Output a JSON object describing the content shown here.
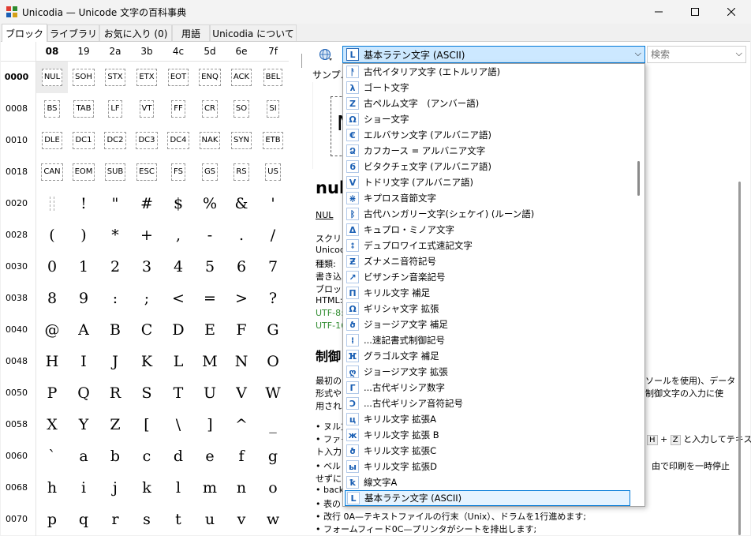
{
  "window": {
    "title": "Unicodia — Unicode 文字の百科事典",
    "minimize": "—",
    "maximize": "☐",
    "close": "✕"
  },
  "tabs": [
    {
      "label": "ブロック",
      "active": true
    },
    {
      "label": "ライブラリ"
    },
    {
      "label": "お気に入り (0)"
    },
    {
      "label": "用語"
    },
    {
      "label": "Unicodia について"
    }
  ],
  "grid": {
    "columns": [
      "08",
      "19",
      "2a",
      "3b",
      "4c",
      "5d",
      "6e",
      "7f"
    ],
    "active_column": "08",
    "rows": [
      {
        "label": "0000",
        "cells": [
          "NUL",
          "SOH",
          "STX",
          "ETX",
          "EOT",
          "ENQ",
          "ACK",
          "BEL"
        ],
        "control": true
      },
      {
        "label": "0008",
        "cells": [
          "BS",
          "TAB",
          "LF",
          "VT",
          "FF",
          "CR",
          "SO",
          "SI"
        ],
        "control": true
      },
      {
        "label": "0010",
        "cells": [
          "DLE",
          "DC1",
          "DC2",
          "DC3",
          "DC4",
          "NAK",
          "SYN",
          "ETB"
        ],
        "control": true
      },
      {
        "label": "0018",
        "cells": [
          "CAN",
          "EOM",
          "SUB",
          "ESC",
          "FS",
          "GS",
          "RS",
          "US"
        ],
        "control": true
      },
      {
        "label": "0020",
        "cells": [
          " ",
          "!",
          "\"",
          "#",
          "$",
          "%",
          "&",
          "'"
        ]
      },
      {
        "label": "0028",
        "cells": [
          "(",
          ")",
          "*",
          "+",
          ",",
          "-",
          ".",
          "/"
        ]
      },
      {
        "label": "0030",
        "cells": [
          "0",
          "1",
          "2",
          "3",
          "4",
          "5",
          "6",
          "7"
        ]
      },
      {
        "label": "0038",
        "cells": [
          "8",
          "9",
          ":",
          ";",
          "<",
          "=",
          ">",
          "?"
        ]
      },
      {
        "label": "0040",
        "cells": [
          "@",
          "A",
          "B",
          "C",
          "D",
          "E",
          "F",
          "G"
        ]
      },
      {
        "label": "0048",
        "cells": [
          "H",
          "I",
          "J",
          "K",
          "L",
          "M",
          "N",
          "O"
        ]
      },
      {
        "label": "0050",
        "cells": [
          "P",
          "Q",
          "R",
          "S",
          "T",
          "U",
          "V",
          "W"
        ]
      },
      {
        "label": "0058",
        "cells": [
          "X",
          "Y",
          "Z",
          "[",
          "\\",
          "]",
          "^",
          "_"
        ]
      },
      {
        "label": "0060",
        "cells": [
          "`",
          "a",
          "b",
          "c",
          "d",
          "e",
          "f",
          "g"
        ]
      },
      {
        "label": "0068",
        "cells": [
          "h",
          "i",
          "j",
          "k",
          "l",
          "m",
          "n",
          "o"
        ]
      },
      {
        "label": "0070",
        "cells": [
          "p",
          "q",
          "r",
          "s",
          "t",
          "u",
          "v",
          "w"
        ]
      }
    ]
  },
  "block_combo": {
    "icon": "L",
    "value": "基本ラテン文字 (ASCII)",
    "arrow": "⌵"
  },
  "search": {
    "placeholder": "検索",
    "arrow": "⌵"
  },
  "dropdown_items": [
    {
      "icon": "ᚨ",
      "label": "古代イタリア文字 (エトルリア語)"
    },
    {
      "icon": "λ",
      "label": "ゴート文字"
    },
    {
      "icon": "Z",
      "label": "古ペルム文字　(アンバー語)"
    },
    {
      "icon": "Ω",
      "label": "ショー文字"
    },
    {
      "icon": "€",
      "label": "エルバサン文字 (アルバニア語)"
    },
    {
      "icon": "Ձ",
      "label": "カフカース = アルバニア文字"
    },
    {
      "icon": "ϭ",
      "label": "ビタクチェ文字 (アルバニア語)"
    },
    {
      "icon": "V",
      "label": "トドリ文字 (アルバニア語)"
    },
    {
      "icon": "⋇",
      "label": "キプロス音節文字"
    },
    {
      "icon": "ᛒ",
      "label": "古代ハンガリー文字(シェケイ) (ルーン語)"
    },
    {
      "icon": "Δ",
      "label": "キュプロ・ミノア文字"
    },
    {
      "icon": "⦂",
      "label": "デュプロワイエ式速記文字"
    },
    {
      "icon": "Ƶ",
      "label": "ズナメニ音符記号"
    },
    {
      "icon": "↗",
      "label": "ビザンチン音楽記号"
    },
    {
      "icon": "Π",
      "label": "キリル文字 補足"
    },
    {
      "icon": "Ω",
      "label": "ギリシャ文字 拡張"
    },
    {
      "icon": "ծ",
      "label": "ジョージア文字 補足"
    },
    {
      "icon": "⁞",
      "label": "...速記書式制御記号"
    },
    {
      "icon": "ⴼ",
      "label": "グラゴル文字 補足"
    },
    {
      "icon": "ღ",
      "label": "ジョージア文字 拡張"
    },
    {
      "icon": "Γ",
      "label": "...古代ギリシア数字"
    },
    {
      "icon": "Ↄ",
      "label": "...古代ギリシア音符記号"
    },
    {
      "icon": "ц",
      "label": "キリル文字 拡張A"
    },
    {
      "icon": "ж",
      "label": "キリル文字 拡張 B"
    },
    {
      "icon": "ծ",
      "label": "キリル文字 拡張C"
    },
    {
      "icon": "ы",
      "label": "キリル文字 拡張D"
    },
    {
      "icon": "ꝁ",
      "label": "線文字A"
    },
    {
      "icon": "L",
      "label": "基本ラテン文字 (ASCII)",
      "selected": true
    }
  ],
  "detail": {
    "sample_label": "サンプル",
    "char_title": "nul",
    "char_abbr": "NUL",
    "script_label": "スクリプ",
    "unicode_label": "Unicod",
    "type_label": "種類: ",
    "write_label": "書き込",
    "block_label": "ブロック",
    "html_label": "HTML:",
    "utf8_label": "UTF-8:",
    "utf16_label": "UTF-16",
    "section_title": "制御",
    "para1a": "最初の",
    "para1b": "ソールを使用)、データ",
    "para2a": "形式や",
    "para2b": "制御文字の入力に使",
    "para3": "用され",
    "bullet1": "• ヌル文",
    "bullet2a": "• ファイル",
    "bullet2b": "と入力してテキス",
    "key_h": "H",
    "key_plus": "+",
    "key_z": "Z",
    "bullet3": "ト入力",
    "bullet4a": "• ベル",
    "bullet4b": "由で印刷を一時停止",
    "bullet5": "せずに",
    "bullet6": "• back",
    "bullet7": "• 表の",
    "bullet8": "• 改行 0A—テキストファイルの行末（Unix）、ドラムを1行進めます;",
    "bullet9": "• フォームフィード0C—プリンタがシートを排出します;"
  },
  "colors": {
    "accent": "#0078d7",
    "link": "#2e8b2e",
    "icon_blue": "#1a5fb4"
  }
}
